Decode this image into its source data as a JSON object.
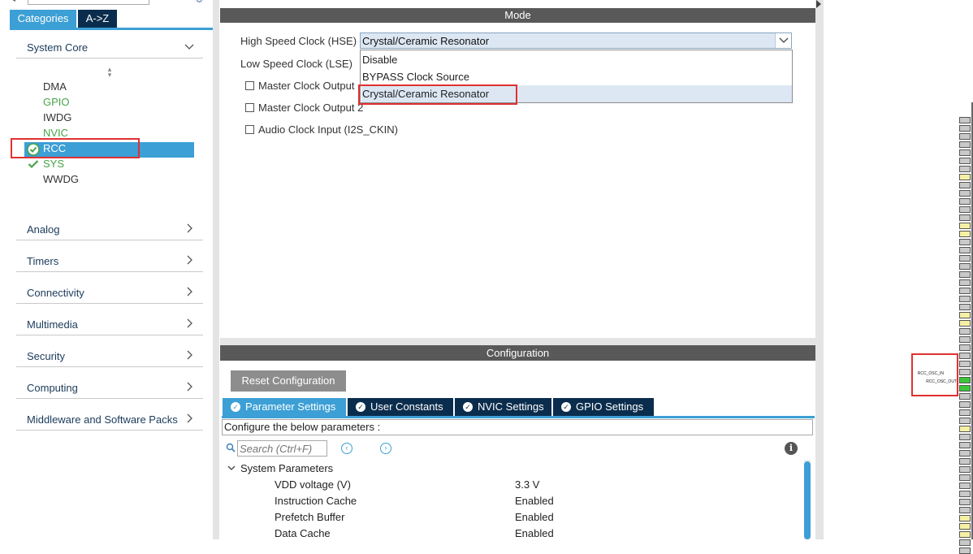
{
  "left_panel": {
    "tabs": {
      "categories": "Categories",
      "az": "A->Z"
    },
    "categories": [
      {
        "label": "System Core",
        "expanded": true
      },
      {
        "label": "Analog"
      },
      {
        "label": "Timers"
      },
      {
        "label": "Connectivity"
      },
      {
        "label": "Multimedia"
      },
      {
        "label": "Security"
      },
      {
        "label": "Computing"
      },
      {
        "label": "Middleware and Software Packs"
      }
    ],
    "system_core_items": [
      {
        "label": "DMA",
        "state": "default"
      },
      {
        "label": "GPIO",
        "state": "configured"
      },
      {
        "label": "IWDG",
        "state": "default"
      },
      {
        "label": "NVIC",
        "state": "configured"
      },
      {
        "label": "RCC",
        "state": "selected"
      },
      {
        "label": "SYS",
        "state": "checked"
      },
      {
        "label": "WWDG",
        "state": "default"
      }
    ]
  },
  "mode": {
    "header": "Mode",
    "hse_label": "High Speed Clock (HSE)",
    "hse_value": "Crystal/Ceramic Resonator",
    "lse_label": "Low Speed Clock (LSE)",
    "dropdown_options": [
      "Disable",
      "BYPASS Clock Source",
      "Crystal/Ceramic Resonator"
    ],
    "checkboxes": [
      "Master Clock Output",
      "Master Clock Output 2",
      "Audio Clock Input (I2S_CKIN)"
    ],
    "mco1_partial": "Master Clock Output"
  },
  "configuration": {
    "header": "Configuration",
    "reset_button": "Reset Configuration",
    "tabs": [
      "Parameter Settings",
      "User Constants",
      "NVIC Settings",
      "GPIO Settings"
    ],
    "description": "Configure the below parameters :",
    "search_placeholder": "Search (Ctrl+F)",
    "group": "System Parameters",
    "params": [
      {
        "name": "VDD voltage (V)",
        "value": "3.3 V"
      },
      {
        "name": "Instruction Cache",
        "value": "Enabled"
      },
      {
        "name": "Prefetch Buffer",
        "value": "Enabled"
      },
      {
        "name": "Data Cache",
        "value": "Enabled"
      }
    ]
  },
  "chip": {
    "pin_labels": [
      "RCC_OSC_IN",
      "RCC_OSC_OUT"
    ]
  },
  "colors": {
    "accent": "#3c9fd5",
    "tab_dark": "#0b2d4d",
    "header_grey": "#595959",
    "highlight_red": "#e03131",
    "configured_green": "#47a447"
  }
}
